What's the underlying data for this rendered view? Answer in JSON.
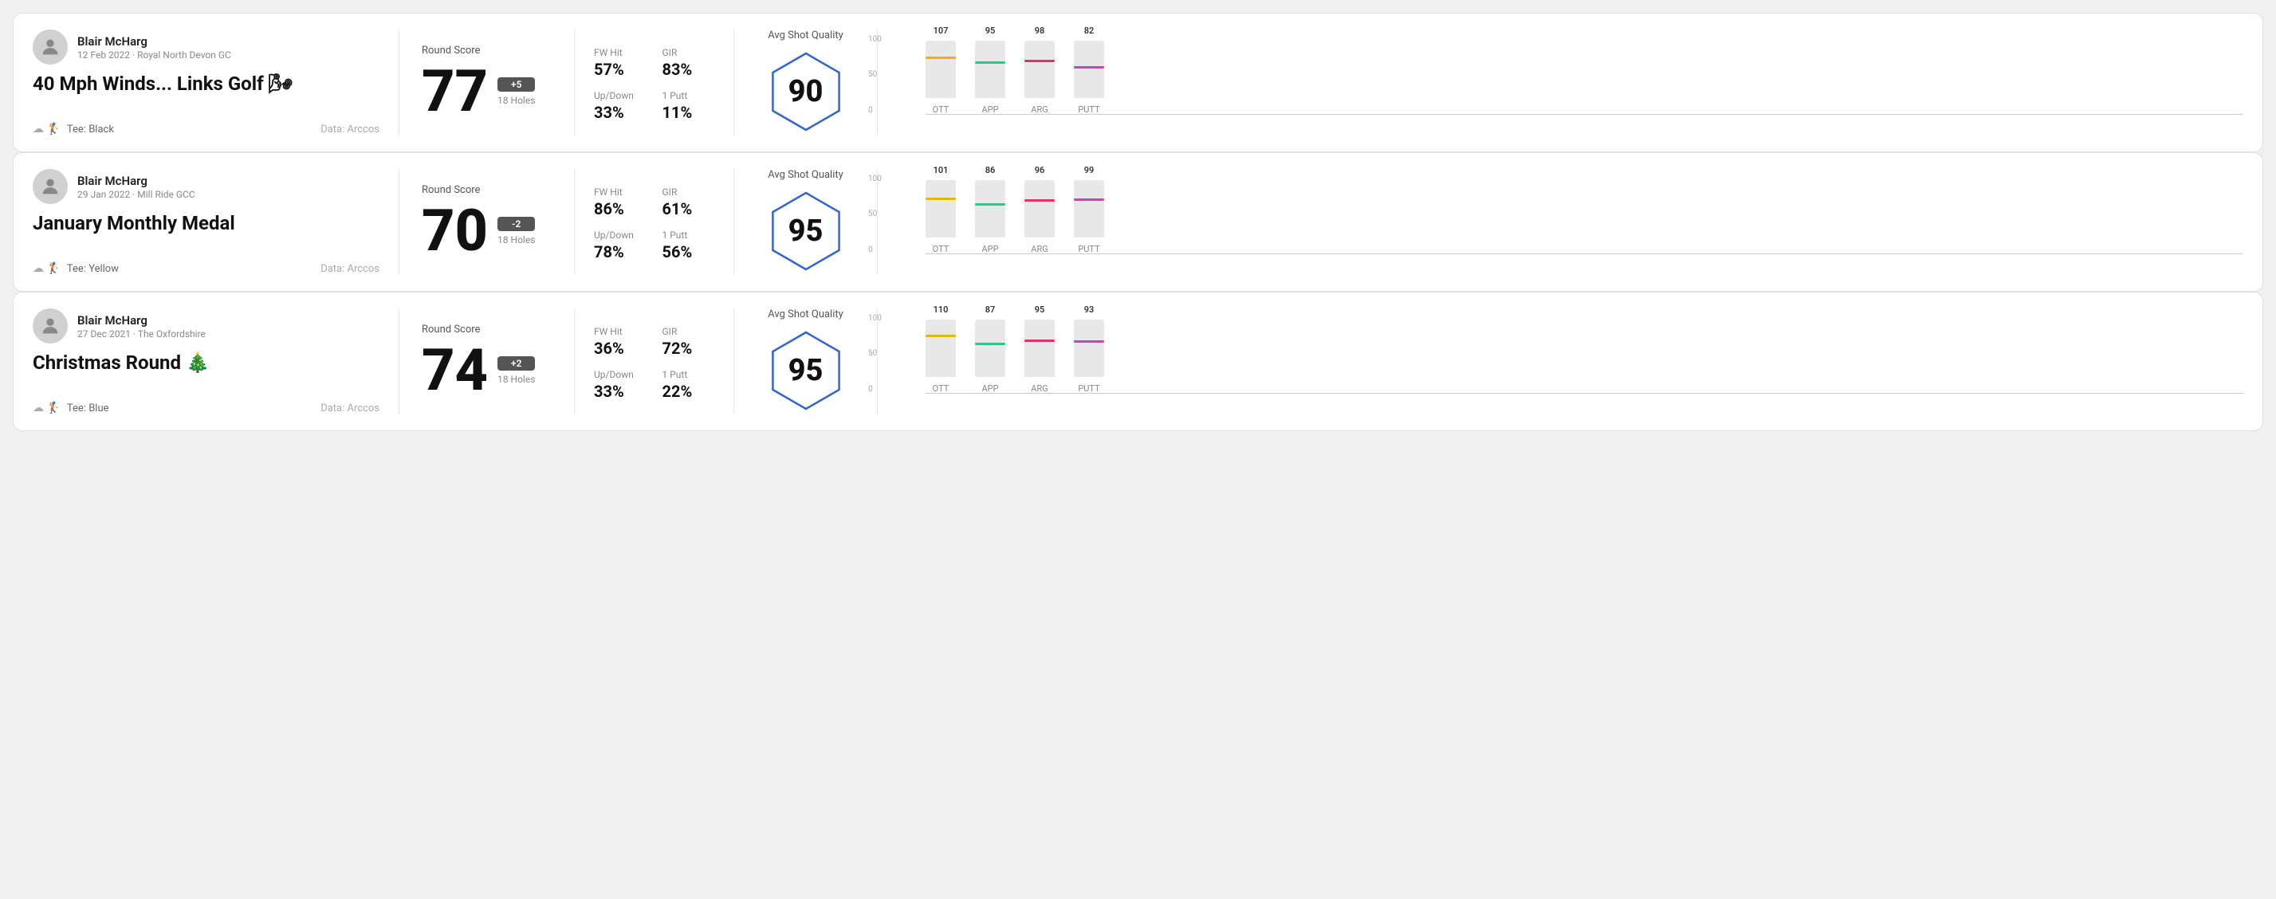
{
  "rounds": [
    {
      "id": "round1",
      "user": {
        "name": "Blair McHarg",
        "date": "12 Feb 2022 · Royal North Devon GC"
      },
      "title": "40 Mph Winds... Links Golf 🌬",
      "tee": "Black",
      "data_source": "Data: Arccos",
      "score": {
        "value": "77",
        "badge": "+5",
        "badge_type": "positive",
        "holes": "18 Holes"
      },
      "stats": {
        "fw_hit_label": "FW Hit",
        "fw_hit_value": "57%",
        "gir_label": "GIR",
        "gir_value": "83%",
        "updown_label": "Up/Down",
        "updown_value": "33%",
        "oneputt_label": "1 Putt",
        "oneputt_value": "11%"
      },
      "quality": {
        "label": "Avg Shot Quality",
        "score": "90"
      },
      "chart": {
        "y_labels": [
          "100",
          "50",
          "0"
        ],
        "columns": [
          {
            "label": "OTT",
            "value": 107,
            "bar_height_pct": 68,
            "color": "#e8b800"
          },
          {
            "label": "APP",
            "value": 95,
            "bar_height_pct": 60,
            "color": "#22cc88"
          },
          {
            "label": "ARG",
            "value": 98,
            "bar_height_pct": 63,
            "color": "#e83060"
          },
          {
            "label": "PUTT",
            "value": 82,
            "bar_height_pct": 52,
            "color": "#cc44aa"
          }
        ]
      }
    },
    {
      "id": "round2",
      "user": {
        "name": "Blair McHarg",
        "date": "29 Jan 2022 · Mill Ride GCC"
      },
      "title": "January Monthly Medal",
      "tee": "Yellow",
      "data_source": "Data: Arccos",
      "score": {
        "value": "70",
        "badge": "-2",
        "badge_type": "negative",
        "holes": "18 Holes"
      },
      "stats": {
        "fw_hit_label": "FW Hit",
        "fw_hit_value": "86%",
        "gir_label": "GIR",
        "gir_value": "61%",
        "updown_label": "Up/Down",
        "updown_value": "78%",
        "oneputt_label": "1 Putt",
        "oneputt_value": "56%"
      },
      "quality": {
        "label": "Avg Shot Quality",
        "score": "95"
      },
      "chart": {
        "y_labels": [
          "100",
          "50",
          "0"
        ],
        "columns": [
          {
            "label": "OTT",
            "value": 101,
            "bar_height_pct": 65,
            "color": "#e8b800"
          },
          {
            "label": "APP",
            "value": 86,
            "bar_height_pct": 55,
            "color": "#22cc88"
          },
          {
            "label": "ARG",
            "value": 96,
            "bar_height_pct": 62,
            "color": "#e83060"
          },
          {
            "label": "PUTT",
            "value": 99,
            "bar_height_pct": 64,
            "color": "#cc44aa"
          }
        ]
      }
    },
    {
      "id": "round3",
      "user": {
        "name": "Blair McHarg",
        "date": "27 Dec 2021 · The Oxfordshire"
      },
      "title": "Christmas Round 🎄",
      "tee": "Blue",
      "data_source": "Data: Arccos",
      "score": {
        "value": "74",
        "badge": "+2",
        "badge_type": "positive",
        "holes": "18 Holes"
      },
      "stats": {
        "fw_hit_label": "FW Hit",
        "fw_hit_value": "36%",
        "gir_label": "GIR",
        "gir_value": "72%",
        "updown_label": "Up/Down",
        "updown_value": "33%",
        "oneputt_label": "1 Putt",
        "oneputt_value": "22%"
      },
      "quality": {
        "label": "Avg Shot Quality",
        "score": "95"
      },
      "chart": {
        "y_labels": [
          "100",
          "50",
          "0"
        ],
        "columns": [
          {
            "label": "OTT",
            "value": 110,
            "bar_height_pct": 70,
            "color": "#e8b800"
          },
          {
            "label": "APP",
            "value": 87,
            "bar_height_pct": 56,
            "color": "#22cc88"
          },
          {
            "label": "ARG",
            "value": 95,
            "bar_height_pct": 61,
            "color": "#e83060"
          },
          {
            "label": "PUTT",
            "value": 93,
            "bar_height_pct": 60,
            "color": "#cc44aa"
          }
        ]
      }
    }
  ],
  "labels": {
    "round_score": "Round Score",
    "avg_shot_quality": "Avg Shot Quality",
    "tee_prefix": "Tee: "
  }
}
